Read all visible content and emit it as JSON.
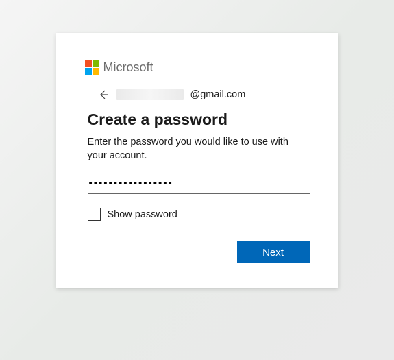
{
  "brand": {
    "name": "Microsoft"
  },
  "identity": {
    "masked": true,
    "domain": "@gmail.com"
  },
  "heading": "Create a password",
  "subtext": "Enter the password you would like to use with your account.",
  "password": {
    "value": "•••••••••••••••••"
  },
  "show_password": {
    "label": "Show password",
    "checked": false
  },
  "actions": {
    "next": "Next"
  }
}
